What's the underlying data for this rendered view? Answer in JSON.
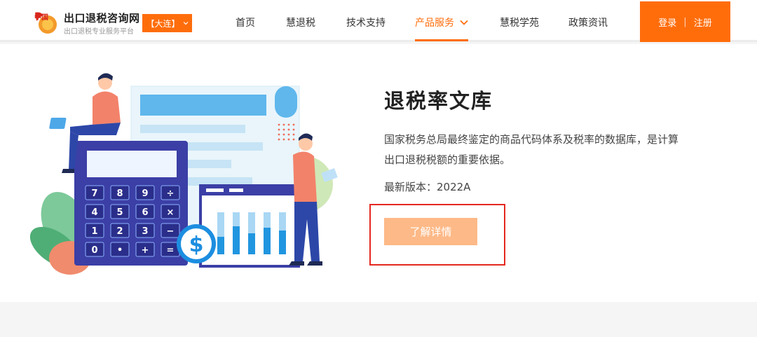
{
  "header": {
    "logo_icon": "china-tax-logo-icon",
    "brand_title": "出口退税咨询网",
    "brand_subtitle": "出口退税专业服务平台",
    "city_label": "【大连】",
    "nav": [
      {
        "label": "首页"
      },
      {
        "label": "慧退税"
      },
      {
        "label": "技术支持"
      },
      {
        "label": "产品服务"
      },
      {
        "label": "慧税学苑"
      },
      {
        "label": "政策资讯"
      }
    ],
    "login_label": "登录",
    "auth_separator": "|",
    "register_label": "注册",
    "accent_color": "#ff6d0b"
  },
  "product": {
    "title": "退税率文库",
    "description": "国家税务总局最终鉴定的商品代码体系及税率的数据库，是计算出口退税税额的重要依据。",
    "version": "最新版本：2022A",
    "detail_button": "了解详情"
  },
  "illustration": {
    "calculator_keys": [
      "7",
      "8",
      "9",
      "÷",
      "4",
      "5",
      "6",
      "×",
      "1",
      "2",
      "3",
      "−",
      "0",
      "•",
      "+",
      "="
    ],
    "dollar_sign": "$",
    "logo_chars": "中国"
  }
}
